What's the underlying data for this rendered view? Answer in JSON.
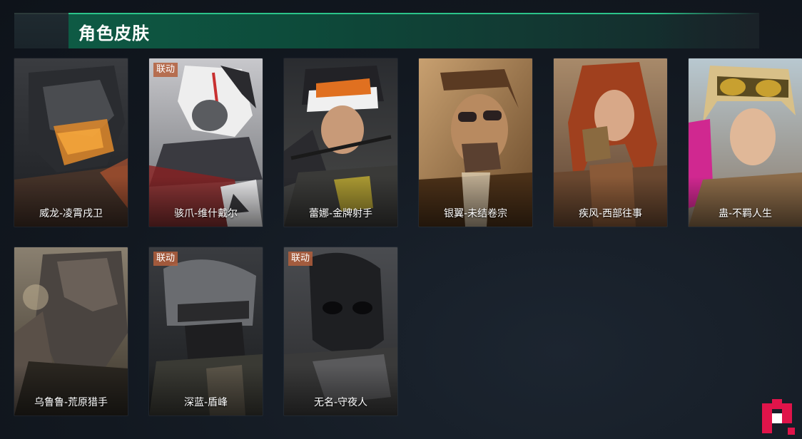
{
  "header": {
    "title": "角色皮肤"
  },
  "skins": [
    {
      "name": "威龙-凌霄戌卫",
      "collab": false,
      "art": "mech-helmet"
    },
    {
      "name": "骇爪-维什戴尔",
      "collab": true,
      "art": "white-hair-mask"
    },
    {
      "name": "蕾娜-金牌射手",
      "collab": false,
      "art": "cap-goggles"
    },
    {
      "name": "银翼-未结卷宗",
      "collab": false,
      "art": "sunglasses-man"
    },
    {
      "name": "疾风-西部往事",
      "collab": false,
      "art": "red-hair-woman"
    },
    {
      "name": "蛊-不羁人生",
      "collab": false,
      "art": "goggles-girl"
    },
    {
      "name": "乌鲁鲁-荒原猎手",
      "collab": false,
      "art": "ghillie-suit"
    },
    {
      "name": "深蓝-盾峰",
      "collab": true,
      "art": "riot-helmet"
    },
    {
      "name": "无名-守夜人",
      "collab": true,
      "art": "black-mask"
    }
  ],
  "badges": {
    "collab_label": "联动"
  },
  "colors": {
    "accent": "#2bc48a",
    "header_green": "#0e5a44",
    "background": "#141a22",
    "collab_badge": "#b45f3c",
    "corner_badge": "#e0144a"
  }
}
